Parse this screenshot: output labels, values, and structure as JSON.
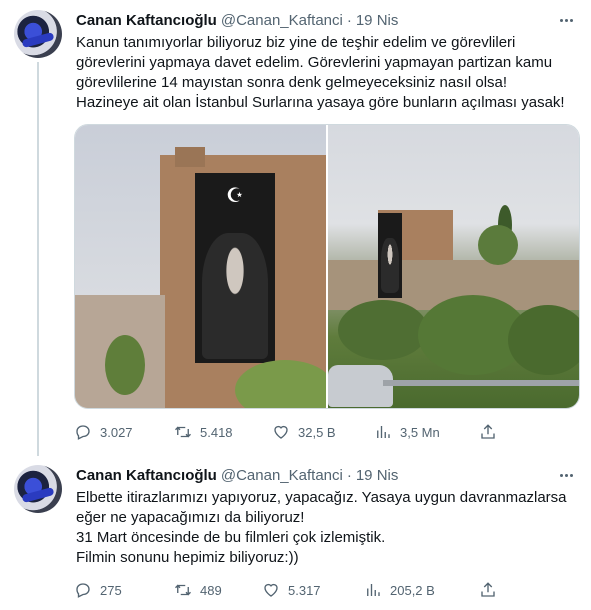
{
  "tweets": [
    {
      "name": "Canan Kaftancıoğlu",
      "handle": "@Canan_Kaftanci",
      "separator": "·",
      "time": "19 Nis",
      "lines": [
        "Kanun tanımıyorlar biliyoruz biz yine de teşhir edelim ve görevlileri",
        "görevlerini yapmaya davet edelim. Görevlerini yapmayan partizan kamu",
        "görevlilerine 14 mayıstan sonra denk gelmeyeceksiniz nasıl olsa!",
        "Hazineye ait olan İstanbul Surlarına yasaya göre bunların açılması yasak!"
      ],
      "stats": {
        "replies": "3.027",
        "retweets": "5.418",
        "likes": "32,5 B",
        "views": "3,5 Mn"
      }
    },
    {
      "name": "Canan Kaftancıoğlu",
      "handle": "@Canan_Kaftanci",
      "separator": "·",
      "time": "19 Nis",
      "lines": [
        "Elbette itirazlarımızı yapıyoruz, yapacağız. Yasaya uygun davranmazlarsa",
        "eğer ne yapacağımızı da biliyoruz!",
        "31 Mart öncesinde de bu filmleri çok izlemiştik.",
        "Filmin sonunu hepimiz biliyoruz:))"
      ],
      "stats": {
        "replies": "275",
        "retweets": "489",
        "likes": "5.317",
        "views": "205,2 B"
      }
    }
  ],
  "icons": {
    "reply": "reply-icon",
    "retweet": "retweet-icon",
    "like": "heart-icon",
    "views": "views-icon",
    "share": "share-icon",
    "more": "more-icon"
  },
  "colors": {
    "text": "#0f1419",
    "secondary": "#536471",
    "border": "#cfd9de"
  }
}
